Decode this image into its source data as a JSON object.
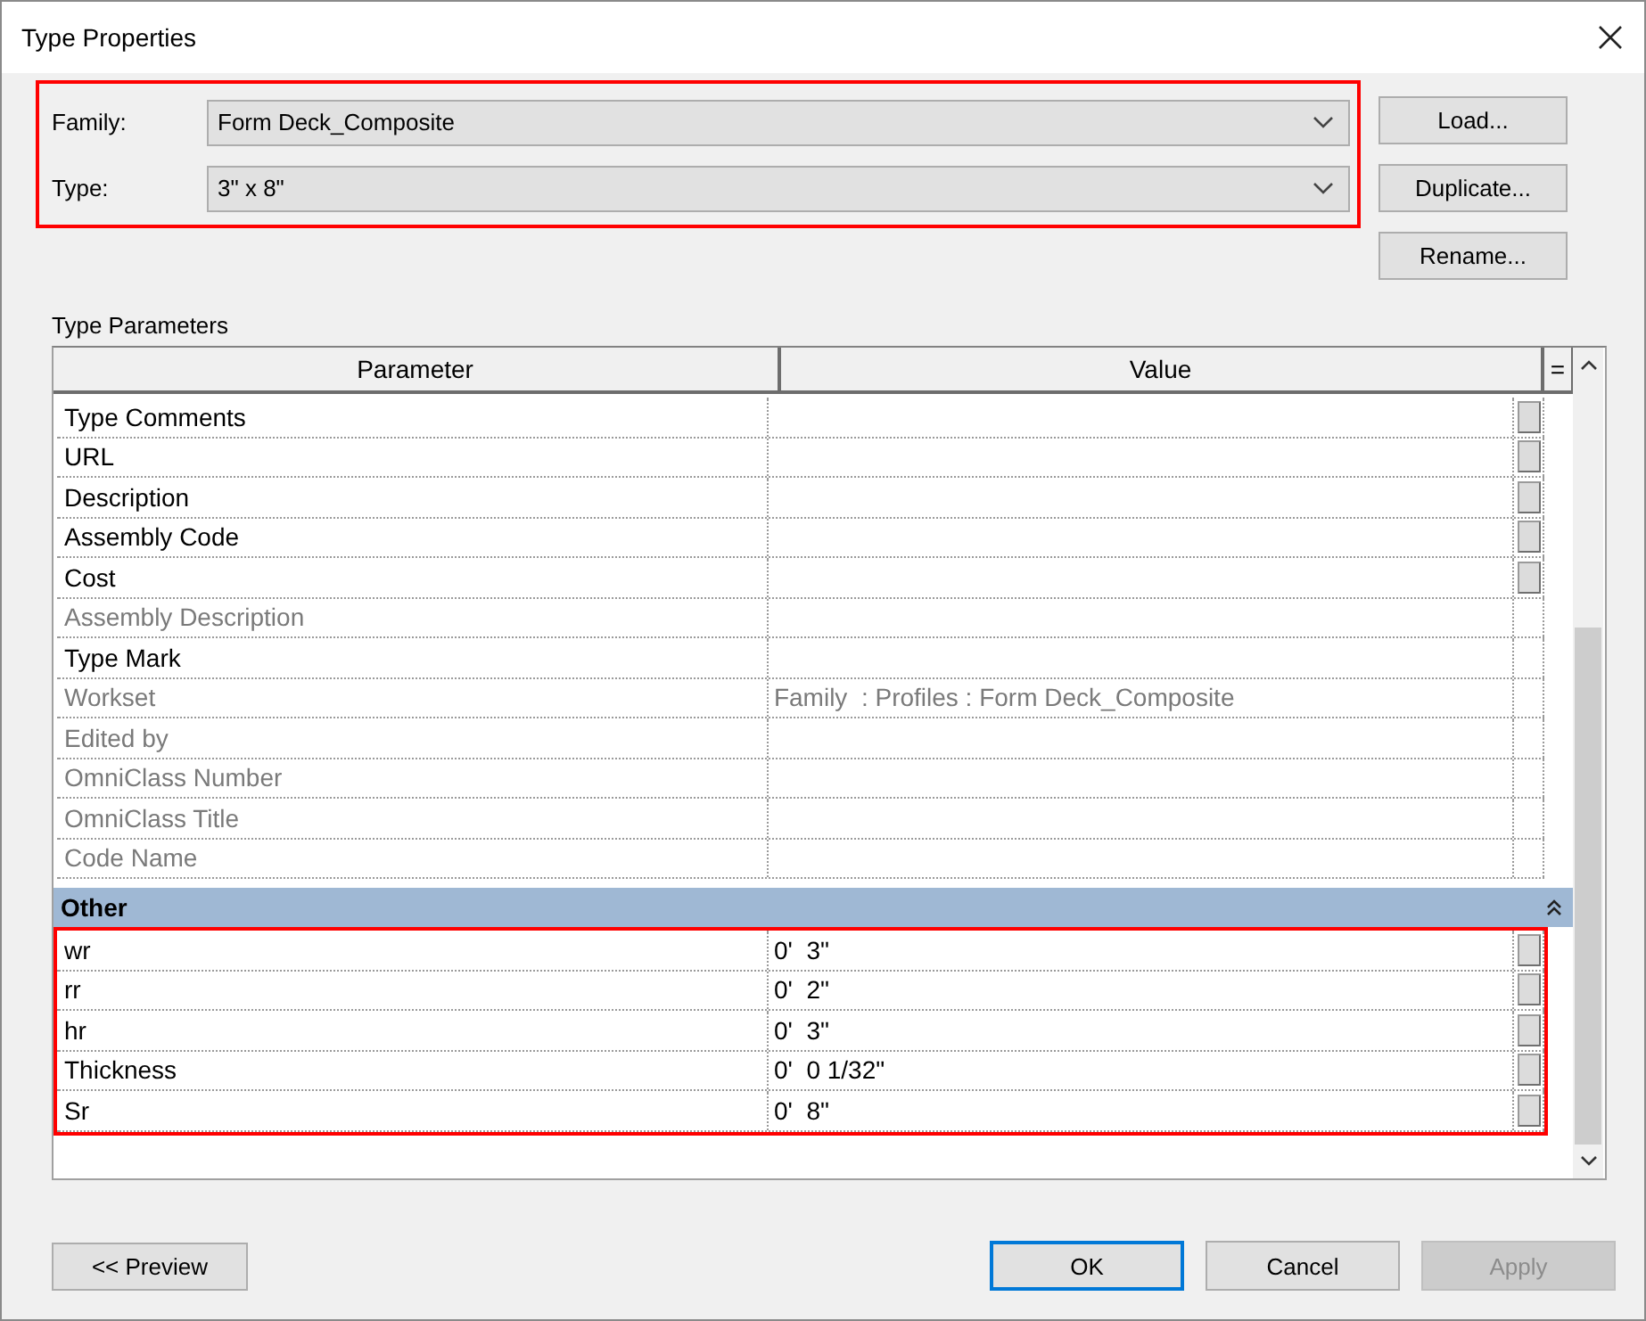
{
  "window": {
    "title": "Type Properties"
  },
  "selector": {
    "highlighted": true,
    "fields": [
      {
        "label": "Family:",
        "value": "Form Deck_Composite"
      },
      {
        "label": "Type:",
        "value": "3\" x 8\""
      }
    ]
  },
  "side_buttons": [
    "Load...",
    "Duplicate...",
    "Rename..."
  ],
  "parameters": {
    "label": "Type Parameters",
    "columns": [
      "Parameter",
      "Value",
      "="
    ],
    "sections": [
      {
        "rows": [
          {
            "name": "Type Comments",
            "disabled": false,
            "linkable": true
          },
          {
            "name": "URL",
            "disabled": false,
            "linkable": true
          },
          {
            "name": "Description",
            "disabled": false,
            "linkable": true
          },
          {
            "name": "Assembly Code",
            "disabled": false,
            "linkable": true
          },
          {
            "name": "Cost",
            "disabled": false,
            "linkable": true
          },
          {
            "name": "Assembly Description",
            "disabled": true,
            "linkable": false
          },
          {
            "name": "Type Mark",
            "disabled": false,
            "linkable": false
          },
          {
            "name": "Workset",
            "value": "Family  : Profiles : Form Deck_Composite",
            "disabled": true,
            "linkable": false
          },
          {
            "name": "Edited by",
            "disabled": true,
            "linkable": false
          },
          {
            "name": "OmniClass Number",
            "disabled": true,
            "linkable": false
          },
          {
            "name": "OmniClass Title",
            "disabled": true,
            "linkable": false
          },
          {
            "name": "Code Name",
            "disabled": true,
            "linkable": false
          }
        ]
      },
      {
        "title": "Other",
        "expanded": true,
        "highlighted": true,
        "rows": [
          {
            "name": "wr",
            "value": "0'  3\"",
            "disabled": false,
            "linkable": true
          },
          {
            "name": "rr",
            "value": "0'  2\"",
            "disabled": false,
            "linkable": true
          },
          {
            "name": "hr",
            "value": "0'  3\"",
            "disabled": false,
            "linkable": true
          },
          {
            "name": "Thickness",
            "value": "0'  0 1/32\"",
            "disabled": false,
            "linkable": true
          },
          {
            "name": "Sr",
            "value": "0'  8\"",
            "disabled": false,
            "linkable": true
          }
        ]
      }
    ]
  },
  "preview_button": {
    "label": "<< Preview"
  },
  "buttons": [
    {
      "label": "OK",
      "default": true,
      "disabled": false
    },
    {
      "label": "Cancel",
      "default": false,
      "disabled": false
    },
    {
      "label": "Apply",
      "default": false,
      "disabled": true
    }
  ]
}
